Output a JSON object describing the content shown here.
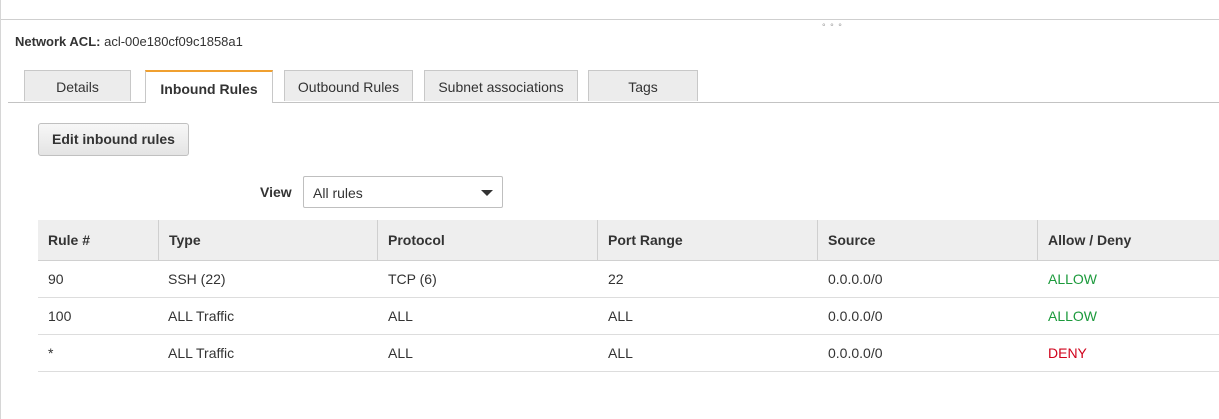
{
  "acl": {
    "label": "Network ACL:",
    "id": "acl-00e180cf09c1858a1"
  },
  "tabs": [
    {
      "label": "Details",
      "active": false
    },
    {
      "label": "Inbound Rules",
      "active": true
    },
    {
      "label": "Outbound Rules",
      "active": false
    },
    {
      "label": "Subnet associations",
      "active": false
    },
    {
      "label": "Tags",
      "active": false
    }
  ],
  "toolbar": {
    "edit_label": "Edit inbound rules"
  },
  "view": {
    "label": "View",
    "selected": "All rules"
  },
  "table": {
    "headers": [
      "Rule #",
      "Type",
      "Protocol",
      "Port Range",
      "Source",
      "Allow / Deny"
    ],
    "rows": [
      {
        "rule": "90",
        "type": "SSH (22)",
        "protocol": "TCP (6)",
        "port_range": "22",
        "source": "0.0.0.0/0",
        "action": "ALLOW"
      },
      {
        "rule": "100",
        "type": "ALL Traffic",
        "protocol": "ALL",
        "port_range": "ALL",
        "source": "0.0.0.0/0",
        "action": "ALLOW"
      },
      {
        "rule": "*",
        "type": "ALL Traffic",
        "protocol": "ALL",
        "port_range": "ALL",
        "source": "0.0.0.0/0",
        "action": "DENY"
      }
    ]
  },
  "colors": {
    "allow": "#1c9a3c",
    "deny": "#d0021b",
    "active_tab_accent": "#f0a030"
  }
}
